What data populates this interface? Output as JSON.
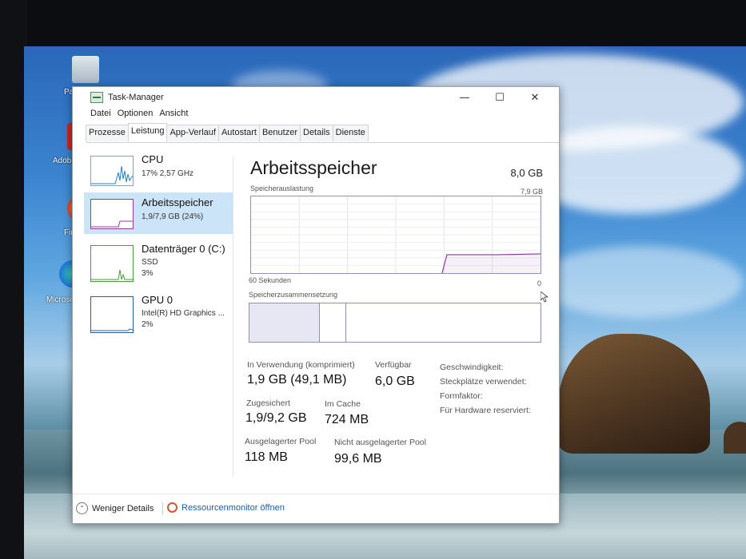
{
  "desktop": {
    "icons": [
      {
        "label": "Papie"
      },
      {
        "label": "Adobe"
      },
      {
        "label": "Fire"
      },
      {
        "label": "Microso"
      }
    ]
  },
  "window": {
    "title": "Task-Manager",
    "controls": {
      "minimize": "—",
      "maximize": "☐",
      "close": "✕"
    },
    "menu": [
      "Datei",
      "Optionen",
      "Ansicht"
    ],
    "tabs": [
      "Prozesse",
      "Leistung",
      "App-Verlauf",
      "Autostart",
      "Benutzer",
      "Details",
      "Dienste"
    ],
    "active_tab": "Leistung"
  },
  "sidebar": {
    "items": [
      {
        "title": "CPU",
        "sub1": "17% 2,57 GHz",
        "sub2": ""
      },
      {
        "title": "Arbeitsspeicher",
        "sub1": "1,9/7,9 GB (24%)",
        "sub2": ""
      },
      {
        "title": "Datenträger 0 (C:)",
        "sub1": "SSD",
        "sub2": "3%"
      },
      {
        "title": "GPU 0",
        "sub1": "Intel(R) HD Graphics ...",
        "sub2": "2%"
      }
    ],
    "selected": 1
  },
  "main": {
    "title": "Arbeitsspeicher",
    "total": "8,0 GB",
    "graph_label": "Speicherauslastung",
    "graph_max": "7,9 GB",
    "graph_time_left": "60 Sekunden",
    "graph_time_right": "0",
    "graph_usage_fraction": 0.24,
    "composition_label": "Speicherzusammensetzung",
    "composition": {
      "in_use_fraction": 0.24,
      "modified_fraction": 0.09
    },
    "stats": {
      "in_use_label": "In Verwendung (komprimiert)",
      "in_use_value": "1,9 GB (49,1 MB)",
      "available_label": "Verfügbar",
      "available_value": "6,0 GB",
      "committed_label": "Zugesichert",
      "committed_value": "1,9/9,2 GB",
      "cached_label": "Im Cache",
      "cached_value": "724 MB",
      "paged_label": "Ausgelagerter Pool",
      "paged_value": "118 MB",
      "nonpaged_label": "Nicht ausgelagerter Pool",
      "nonpaged_value": "99,6 MB"
    },
    "properties": [
      "Geschwindigkeit:",
      "Steckplätze verwendet:",
      "Formfaktor:",
      "Für Hardware reserviert:"
    ]
  },
  "footer": {
    "fewer_details": "Weniger Details",
    "resource_monitor": "Ressourcenmonitor öffnen"
  },
  "colors": {
    "accent": "#cce4f7",
    "memory_line": "#8b3f9e",
    "graph_border": "#8b93b5"
  }
}
